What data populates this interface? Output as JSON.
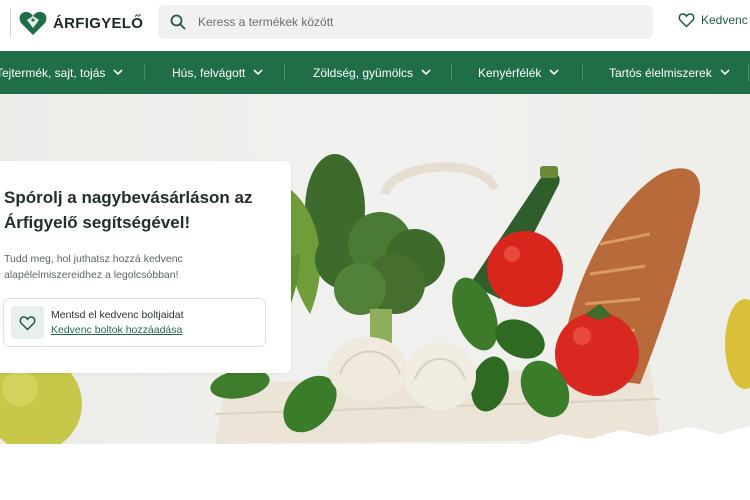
{
  "brand": {
    "name": "ÁRFIGYELŐ",
    "color": "#1f6e47"
  },
  "search": {
    "placeholder": "Keress a termékek között"
  },
  "favorites": {
    "label": "Kedvenc b"
  },
  "nav": [
    {
      "label": "Tejtermék, sajt, tojás"
    },
    {
      "label": "Hús, felvágott"
    },
    {
      "label": "Zöldség, gyümölcs"
    },
    {
      "label": "Kenyérfélék"
    },
    {
      "label": "Tartós élelmiszerek"
    }
  ],
  "hero": {
    "title": "Spórolj a nagybevásárláson az Árfigyelő segítségével!",
    "subtitle": "Tudd meg, hol juthatsz hozzá kedvenc alapélelmiszereidhez a legolcsóbban!",
    "save_title": "Mentsd el kedvenc boltjaidat",
    "save_link": "Kedvenc boltok hozzáadása"
  },
  "icons": {
    "logo": "heart-tag-icon",
    "search": "search-icon",
    "favorites": "heart-icon",
    "chevron": "chevron-down-icon",
    "save": "heart-outline-icon"
  }
}
